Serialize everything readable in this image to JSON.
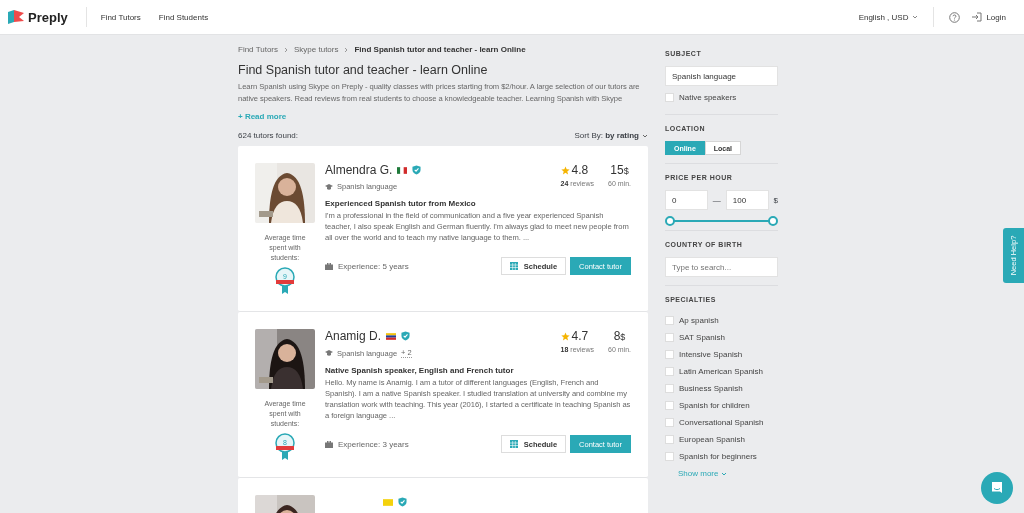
{
  "header": {
    "logo": "Preply",
    "nav": [
      {
        "label": "Find Tutors"
      },
      {
        "label": "Find Students"
      }
    ],
    "language": "English , USD",
    "login": "Login"
  },
  "breadcrumbs": [
    {
      "label": "Find Tutors",
      "current": false
    },
    {
      "label": "Skype tutors",
      "current": false
    },
    {
      "label": "Find Spanish tutor and teacher - learn Online",
      "current": true
    }
  ],
  "title": "Find Spanish tutor and teacher - learn Online",
  "description": "Learn Spanish using Skype on Preply - quality classes with prices starting from $2/hour. A large selection of our tutors are native speakers. Read reviews from real students to choose a knowledgeable teacher. Learning Spanish with Skype",
  "read_more": "+ Read more",
  "tutors_found": "624 tutors found:",
  "sort": {
    "label": "Sort By:",
    "value": "by rating"
  },
  "tutors": [
    {
      "name": "Almendra G.",
      "verified": true,
      "subject": "Spanish language",
      "rating": "4.8",
      "reviews_count": "24",
      "reviews_label": "reviews",
      "price": "15",
      "currency": "$",
      "duration": "60 min.",
      "headline": "Experienced Spanish tutor from Mexico",
      "bio": "I'm a professional in the field of communication and a five year experienced Spanish teacher, I also speak English and German fluently. I'm always glad to meet new people from all over the world and to teach my native language to them. ...",
      "experience": "Experience: 5 years",
      "avg_time_label": "Average time spent with students:",
      "badge_number": "9",
      "schedule": "Schedule",
      "contact": "Contact tutor"
    },
    {
      "name": "Anamig D.",
      "verified": true,
      "subject": "Spanish language",
      "extra": "+ 2",
      "rating": "4.7",
      "reviews_count": "18",
      "reviews_label": "reviews",
      "price": "8",
      "currency": "$",
      "duration": "60 min.",
      "headline": "Native Spanish speaker, English and French tutor",
      "bio": "Hello. My name is Anamig. I am a tutor of different languages (English, French and Spanish). I am a native Spanish speaker. I studied translation at university and combine my translation work with teaching. This year (2016), I started a certificate in teaching Spanish as a foreign language ...",
      "experience": "Experience: 3 years",
      "avg_time_label": "Average time spent with students:",
      "badge_number": "8",
      "schedule": "Schedule",
      "contact": "Contact tutor"
    }
  ],
  "next_tutor": {
    "verified": true
  },
  "sidebar": {
    "subject": {
      "heading": "SUBJECT",
      "value": "Spanish language",
      "native_label": "Native speakers",
      "native_checked": false
    },
    "location": {
      "heading": "LOCATION",
      "options": [
        {
          "label": "Online",
          "selected": true
        },
        {
          "label": "Local",
          "selected": false
        }
      ]
    },
    "price": {
      "heading": "PRICE PER HOUR",
      "min": "0",
      "max": "100",
      "currency": "$",
      "separator": "—",
      "thumbs": [
        {
          "level": 0
        },
        {
          "level": 1
        }
      ]
    },
    "country": {
      "heading": "COUNTRY OF BIRTH",
      "placeholder": "Type to search..."
    },
    "specialties": {
      "heading": "SPECIALTIES",
      "items": [
        {
          "label": "Ap spanish",
          "checked": false
        },
        {
          "label": "SAT Spanish",
          "checked": false
        },
        {
          "label": "Intensive Spanish",
          "checked": false
        },
        {
          "label": "Latin American Spanish",
          "checked": false
        },
        {
          "label": "Business Spanish",
          "checked": false
        },
        {
          "label": "Spanish for children",
          "checked": false
        },
        {
          "label": "Conversational Spanish",
          "checked": false
        },
        {
          "label": "European Spanish",
          "checked": false
        },
        {
          "label": "Spanish for beginners",
          "checked": false
        }
      ],
      "show_more": "Show more"
    }
  },
  "help_tab": "Need Help?"
}
